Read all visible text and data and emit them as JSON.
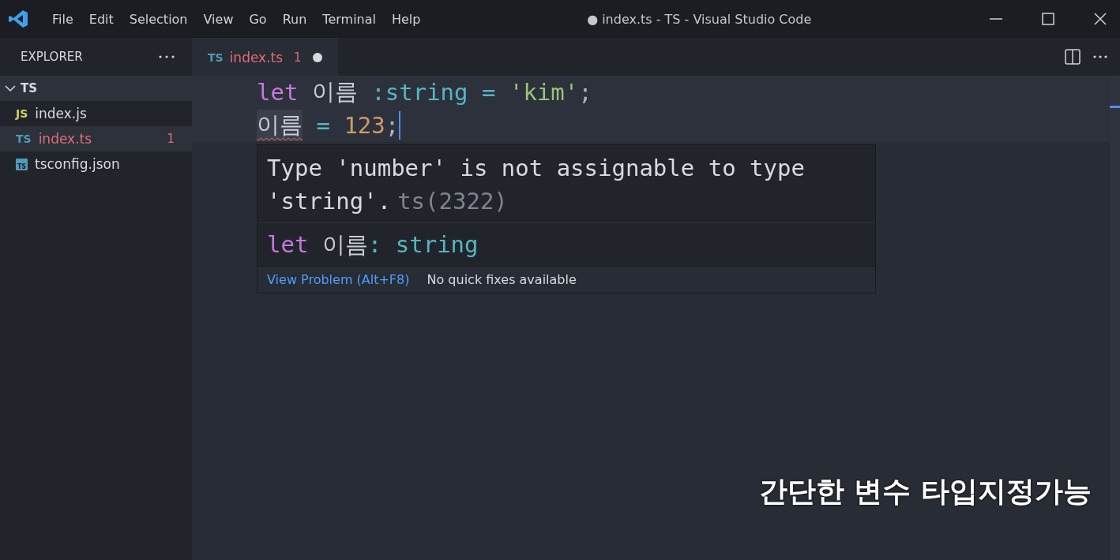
{
  "window": {
    "title": "● index.ts - TS - Visual Studio Code"
  },
  "menu": [
    "File",
    "Edit",
    "Selection",
    "View",
    "Go",
    "Run",
    "Terminal",
    "Help"
  ],
  "sidebar": {
    "title": "EXPLORER",
    "folder": {
      "name": "TS",
      "expanded": true,
      "children": [
        {
          "name": "index.js",
          "icon": "JS",
          "kind": "js",
          "selected": false,
          "has_error": false
        },
        {
          "name": "index.ts",
          "icon": "TS",
          "kind": "ts",
          "selected": true,
          "has_error": true,
          "problems": "1"
        },
        {
          "name": "tsconfig.json",
          "icon": "TS",
          "kind": "config",
          "selected": false,
          "has_error": false
        }
      ]
    }
  },
  "tabs": [
    {
      "icon": "TS",
      "label": "index.ts",
      "problems": "1",
      "modified": true,
      "selected": true,
      "has_error": true
    }
  ],
  "editor": {
    "lines": [
      {
        "cursor": false,
        "tokens": [
          {
            "text": "let ",
            "kind": "keyword",
            "error": false,
            "highlighted": false
          },
          {
            "text": "이름 ",
            "kind": "variable",
            "error": false,
            "highlighted": false
          },
          {
            "text": ":string ",
            "kind": "type",
            "error": false,
            "highlighted": false
          },
          {
            "text": "= ",
            "kind": "operator",
            "error": false,
            "highlighted": false
          },
          {
            "text": "'kim'",
            "kind": "string",
            "error": false,
            "highlighted": false
          },
          {
            "text": ";",
            "kind": "punct",
            "error": false,
            "highlighted": false
          }
        ]
      },
      {
        "cursor": true,
        "tokens": [
          {
            "text": "이름",
            "kind": "variable",
            "error": true,
            "highlighted": true
          },
          {
            "text": " = ",
            "kind": "operator",
            "error": false,
            "highlighted": false
          },
          {
            "text": "123",
            "kind": "number",
            "error": false,
            "highlighted": false
          },
          {
            "text": ";",
            "kind": "punct",
            "error": false,
            "highlighted": false
          }
        ]
      }
    ],
    "hover": {
      "message": "Type 'number' is not assignable to type 'string'.",
      "code": "ts(2322)",
      "signature": [
        {
          "text": "let ",
          "kind": "keyword"
        },
        {
          "text": "이름",
          "kind": "variable"
        },
        {
          "text": ": ",
          "kind": "type"
        },
        {
          "text": "string",
          "kind": "type"
        }
      ],
      "actions": [
        {
          "kind": "link",
          "label": "View Problem (Alt+F8)"
        },
        {
          "kind": "note",
          "label": "No quick fixes available"
        }
      ]
    }
  },
  "caption": "간단한 변수 타입지정가능"
}
